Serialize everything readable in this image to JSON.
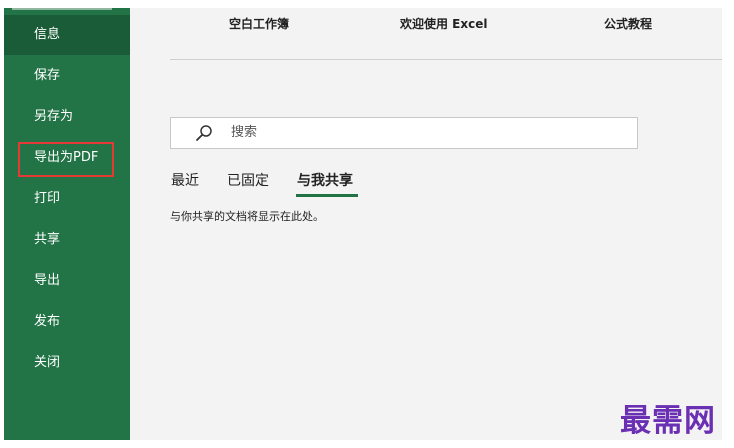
{
  "sidebar": {
    "items": [
      {
        "label": "信息",
        "active": true
      },
      {
        "label": "保存"
      },
      {
        "label": "另存为"
      },
      {
        "label": "导出为PDF",
        "highlighted": true
      },
      {
        "label": "打印"
      },
      {
        "label": "共享"
      },
      {
        "label": "导出"
      },
      {
        "label": "发布"
      },
      {
        "label": "关闭"
      }
    ]
  },
  "templates": [
    "空白工作簿",
    "欢迎使用 Excel",
    "公式教程"
  ],
  "search": {
    "placeholder": "搜索",
    "icon": "search-icon"
  },
  "tabs": [
    {
      "label": "最近"
    },
    {
      "label": "已固定"
    },
    {
      "label": "与我共享",
      "active": true
    }
  ],
  "empty_message": "与你共享的文档将显示在此处。",
  "watermark": "最需网",
  "colors": {
    "sidebar": "#227447",
    "sidebar_active": "#1a5c37",
    "highlight_border": "#e53935",
    "tab_underline": "#217346",
    "watermark": "#6a2fb3"
  }
}
